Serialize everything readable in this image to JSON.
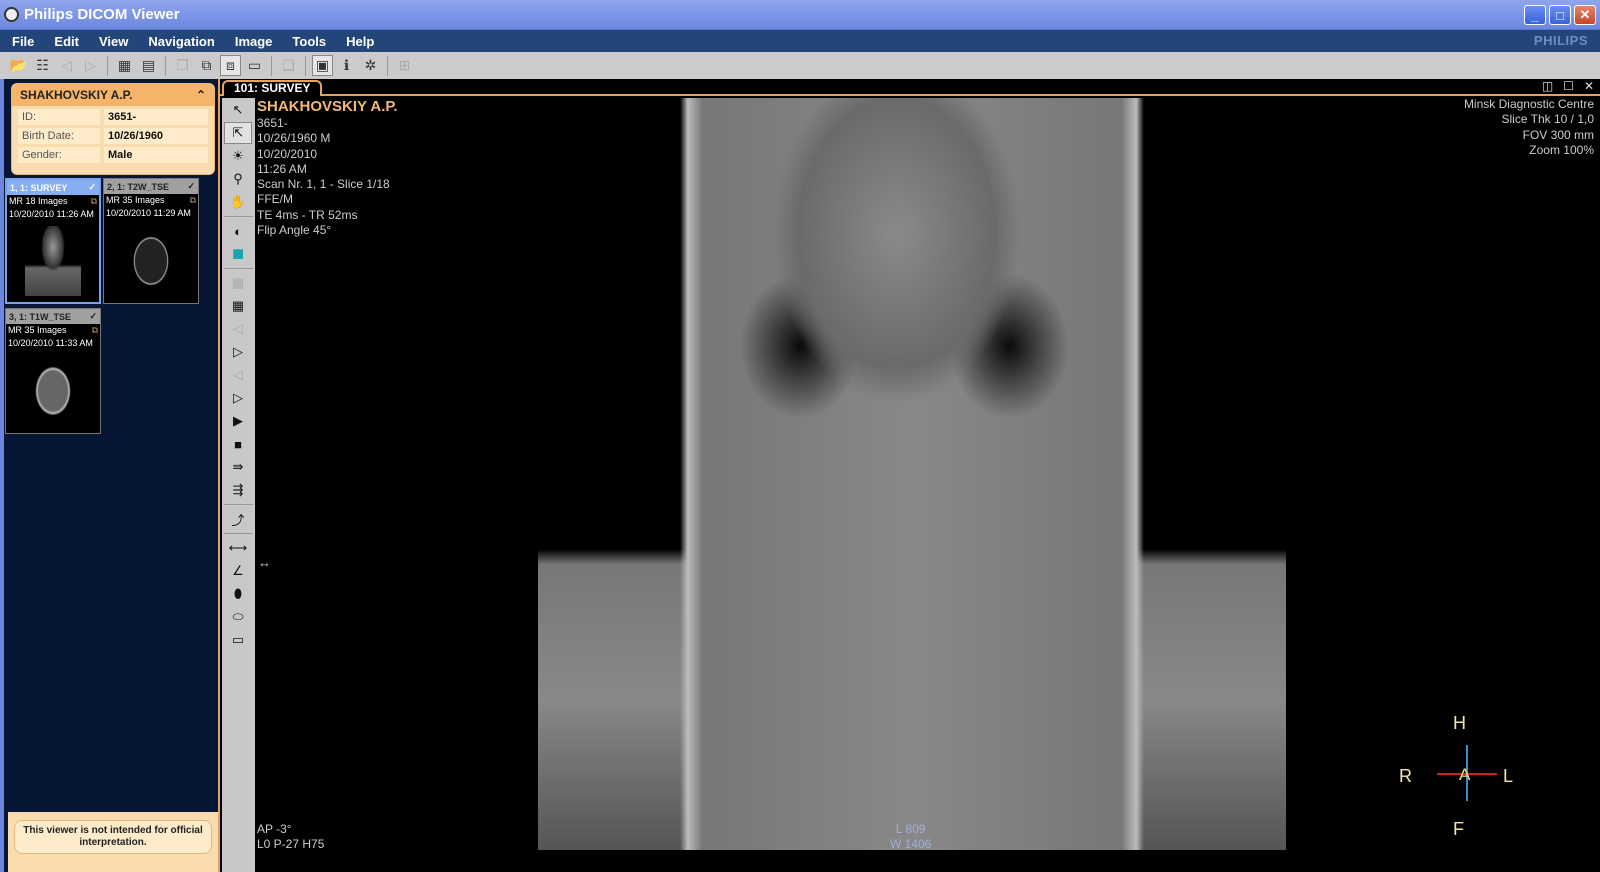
{
  "window": {
    "title": "Philips DICOM Viewer",
    "minimize": "_",
    "maximize": "□",
    "close": "✕"
  },
  "menu": [
    "File",
    "Edit",
    "View",
    "Navigation",
    "Image",
    "Tools",
    "Help"
  ],
  "brand": "PHILIPS",
  "toolbar": [
    {
      "icon": "open-folder-icon",
      "glyph": "📂",
      "state": "normal"
    },
    {
      "icon": "patient-list-icon",
      "glyph": "☷",
      "state": "normal"
    },
    {
      "icon": "prev-icon",
      "glyph": "◁",
      "state": "disabled"
    },
    {
      "icon": "next-icon",
      "glyph": "▷",
      "state": "disabled"
    },
    {
      "sep": true
    },
    {
      "icon": "print-icon",
      "glyph": "▦",
      "state": "normal"
    },
    {
      "icon": "print-preview-icon",
      "glyph": "▤",
      "state": "normal"
    },
    {
      "sep": true
    },
    {
      "icon": "copy-disabled-icon",
      "glyph": "❐",
      "state": "disabled"
    },
    {
      "icon": "export-forward-icon",
      "glyph": "⧉",
      "state": "normal"
    },
    {
      "icon": "export-back-icon",
      "glyph": "⧈",
      "state": "active"
    },
    {
      "icon": "folder-back-icon",
      "glyph": "▭",
      "state": "normal"
    },
    {
      "sep": true
    },
    {
      "icon": "duplicate-icon",
      "glyph": "❏",
      "state": "disabled"
    },
    {
      "sep": true
    },
    {
      "icon": "layout-icon",
      "glyph": "▣",
      "state": "active"
    },
    {
      "icon": "info-icon",
      "glyph": "ℹ",
      "state": "normal"
    },
    {
      "icon": "sync-icon",
      "glyph": "✲",
      "state": "normal"
    },
    {
      "sep": true
    },
    {
      "icon": "tile-icon",
      "glyph": "⊞",
      "state": "disabled"
    }
  ],
  "patient": {
    "name": "SHAKHOVSKIY A.P.",
    "fields": [
      {
        "label": "ID:",
        "value": "3651-"
      },
      {
        "label": "Birth Date:",
        "value": "10/26/1960"
      },
      {
        "label": "Gender:",
        "value": "Male"
      }
    ]
  },
  "series": [
    {
      "title": "1, 1: SURVEY",
      "count": "MR 18 Images",
      "date": "10/20/2010 11:26 AM",
      "selected": true
    },
    {
      "title": "2, 1: T2W_TSE",
      "count": "MR 35 Images",
      "date": "10/20/2010 11:29 AM",
      "selected": false
    },
    {
      "title": "3, 1: T1W_TSE",
      "count": "MR 35 Images",
      "date": "10/20/2010 11:33 AM",
      "selected": false
    }
  ],
  "disclaimer": "This viewer is not intended for official interpretation.",
  "viewer": {
    "tab": "101: SURVEY",
    "overlay_top_left": {
      "name": "SHAKHOVSKIY A.P.",
      "lines": [
        "3651-",
        "10/26/1960    M",
        "10/20/2010",
        "11:26 AM",
        "Scan Nr. 1, 1 - Slice 1/18",
        "FFE/M",
        "TE   4ms - TR  52ms",
        "Flip Angle 45°"
      ]
    },
    "overlay_top_right": [
      "Minsk Diagnostic Centre",
      "Slice Thk 10 / 1,0",
      "FOV 300 mm",
      "Zoom 100%"
    ],
    "overlay_bottom_left": [
      "AP -3°",
      "L0 P-27 H75"
    ],
    "overlay_bottom_center": [
      "L 809",
      "W 1406"
    ],
    "orientation": {
      "top": "H",
      "bottom": "F",
      "left": "R",
      "right": "L",
      "center": "A"
    }
  },
  "vtools": [
    {
      "icon": "pointer-icon",
      "glyph": "↖",
      "state": "normal"
    },
    {
      "icon": "pointer-stack-icon",
      "glyph": "⇱",
      "state": "active"
    },
    {
      "icon": "window-level-icon",
      "glyph": "☀",
      "state": "normal"
    },
    {
      "icon": "zoom-icon",
      "glyph": "⚲",
      "state": "normal"
    },
    {
      "icon": "pan-hand-icon",
      "glyph": "✋",
      "state": "normal"
    },
    {
      "sep": true
    },
    {
      "icon": "invert-icon",
      "glyph": "◐",
      "state": "normal"
    },
    {
      "icon": "color-swatch-icon",
      "glyph": "■",
      "state": "normal",
      "color": "#1aa5ad"
    },
    {
      "sep": true
    },
    {
      "icon": "grid-up-icon",
      "glyph": "▦",
      "state": "disabled"
    },
    {
      "icon": "grid-layout-icon",
      "glyph": "▦",
      "state": "normal"
    },
    {
      "icon": "first-image-icon",
      "glyph": "◁",
      "state": "disabled"
    },
    {
      "icon": "prev-series-icon",
      "glyph": "▷",
      "state": "normal"
    },
    {
      "icon": "prev-image-icon",
      "glyph": "◁",
      "state": "disabled"
    },
    {
      "icon": "next-series-icon",
      "glyph": "▷",
      "state": "normal"
    },
    {
      "icon": "play-icon",
      "glyph": "▶",
      "state": "normal"
    },
    {
      "icon": "stop-icon",
      "glyph": "■",
      "state": "normal"
    },
    {
      "icon": "fast-back-icon",
      "glyph": "⇛",
      "state": "normal"
    },
    {
      "icon": "fast-forward-icon",
      "glyph": "⇶",
      "state": "normal"
    },
    {
      "sep": true
    },
    {
      "icon": "reset-icon",
      "glyph": "⤴",
      "state": "normal"
    },
    {
      "sep": true
    },
    {
      "icon": "ruler-icon",
      "glyph": "⟷",
      "state": "normal"
    },
    {
      "icon": "angle-icon",
      "glyph": "∠",
      "state": "normal"
    },
    {
      "icon": "freehand-roi-icon",
      "glyph": "⬮",
      "state": "normal"
    },
    {
      "icon": "ellipse-roi-icon",
      "glyph": "⬭",
      "state": "normal"
    },
    {
      "icon": "rect-roi-icon",
      "glyph": "▭",
      "state": "normal"
    }
  ],
  "colors": {
    "accent": "#e7a35e",
    "titlebar": "#7b93e5",
    "menubar": "#23467a",
    "panel": "#061634"
  }
}
